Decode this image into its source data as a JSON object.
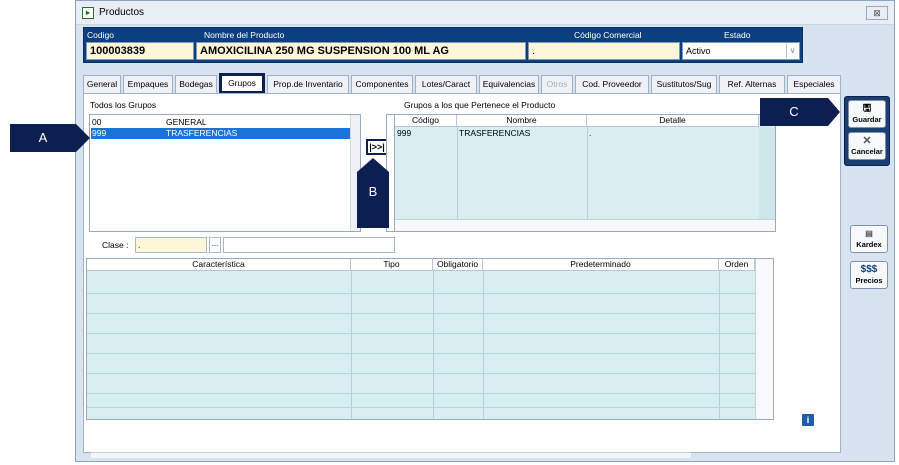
{
  "window": {
    "title": "Productos",
    "close_label": "⊠"
  },
  "header": {
    "columns": [
      "Codigo",
      "Nombre del Producto",
      "Código Comercial",
      "Estado"
    ],
    "codigo": "100003839",
    "nombre": "AMOXICILINA 250 MG SUSPENSION 100 ML AG",
    "codigo_comercial": ".",
    "estado": "Activo"
  },
  "tabs": [
    {
      "label": "General"
    },
    {
      "label": "Empaques"
    },
    {
      "label": "Bodegas"
    },
    {
      "label": "Grupos",
      "active": true
    },
    {
      "label": "Prop.de Inventario"
    },
    {
      "label": "Componentes"
    },
    {
      "label": "Lotes/Caract"
    },
    {
      "label": "Equivalencias"
    },
    {
      "label": "Otros",
      "disabled": true
    },
    {
      "label": "Cod. Proveedor"
    },
    {
      "label": "Sustitutos/Sug"
    },
    {
      "label": "Ref. Alternas"
    },
    {
      "label": "Especiales"
    }
  ],
  "groups_panel": {
    "all_title": "Todos los Grupos",
    "all_items": [
      {
        "code": "00",
        "name": "GENERAL",
        "selected": false
      },
      {
        "code": "999",
        "name": "TRASFERENCIAS",
        "selected": true
      }
    ],
    "add_button_label": "|>>|",
    "member_title": "Grupos a los que Pertenece el Producto",
    "member_columns": [
      "Código",
      "Nombre",
      "Detalle"
    ],
    "member_rows": [
      {
        "codigo": "999",
        "nombre": "TRASFERENCIAS",
        "detalle": "."
      }
    ]
  },
  "clase": {
    "label": "Clase :",
    "value": ".",
    "button_label": "...",
    "description": ""
  },
  "characteristics_grid": {
    "columns": [
      "Característica",
      "Tipo",
      "Obligatorio",
      "Predeterminado",
      "Orden"
    ]
  },
  "side_buttons": {
    "guardar": "Guardar",
    "cancelar": "Cancelar",
    "kardex": "Kardex",
    "precios_symbol": "$$$",
    "precios": "Precios"
  },
  "info_label": "i",
  "callouts": {
    "a": "A",
    "b": "B",
    "c": "C"
  },
  "colors": {
    "header_bg": "#0c3f80",
    "selection": "#1a73d6",
    "grid_bg": "#d9eef1",
    "callout_bg": "#0c1f50",
    "field_bg": "#fdf6d8"
  }
}
